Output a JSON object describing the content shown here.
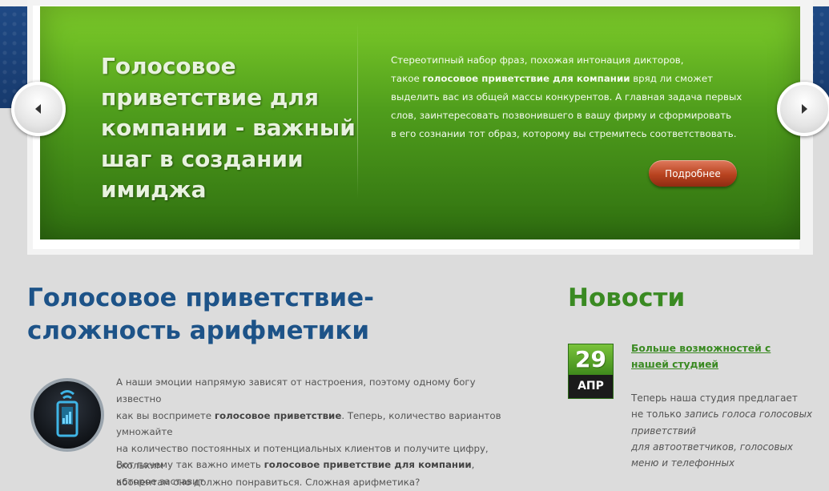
{
  "slider": {
    "title": "Голосовое приветствие для компании - важный шаг в создании имиджа",
    "text_1": "Стереотипный набор фраз, похожая интонация дикторов,",
    "text_2a": "такое ",
    "text_2b": "голосовое приветствие для компании",
    "text_2c": " вряд ли сможет",
    "text_3": "выделить вас из общей массы конкурентов. А главная задача первых",
    "text_4": "слов, заинтересовать позвонившего в вашу фирму и сформировать",
    "text_5": "в его сознании тот образ, которому вы стремитесь соответствовать.",
    "more_label": "Подробнее",
    "prev_icon": "chevron-left-icon",
    "next_icon": "chevron-right-icon"
  },
  "article": {
    "title": "Голосовое приветствие- сложность арифметики",
    "p1_line1": "А наши эмоции напрямую зависят от настроения, поэтому одному богу известно",
    "p1_line2a": "как вы воспримете ",
    "p1_line2b": "голосовое приветствие",
    "p1_line2c": ". Теперь, количество вариантов умножайте",
    "p1_line3": "на количество постоянных и потенциальных клиентов и получите цифру, скольким",
    "p1_line4": "абонентам оно должно понравиться. Сложная арифметика?",
    "p2_a": "Вот почему так важно иметь ",
    "p2_b": "голосовое приветствие для компании",
    "p2_c": ", которое заставит",
    "icon": "phone-signal-icon"
  },
  "news": {
    "title": "Новости",
    "day": "29",
    "month": "АПР",
    "link": "Больше возможностей с нашей студией",
    "text_1": "Теперь наша студия предлагает",
    "text_2a": "не только ",
    "text_2b": "запись голоса голосовых приветствий",
    "text_3": "для автоответчиков, голосовых меню и телефонных"
  },
  "colors": {
    "article_title": "#1d5388",
    "news_title": "#3a8a22",
    "slide_green": "#4f9d1c",
    "button": "#b8431f"
  }
}
